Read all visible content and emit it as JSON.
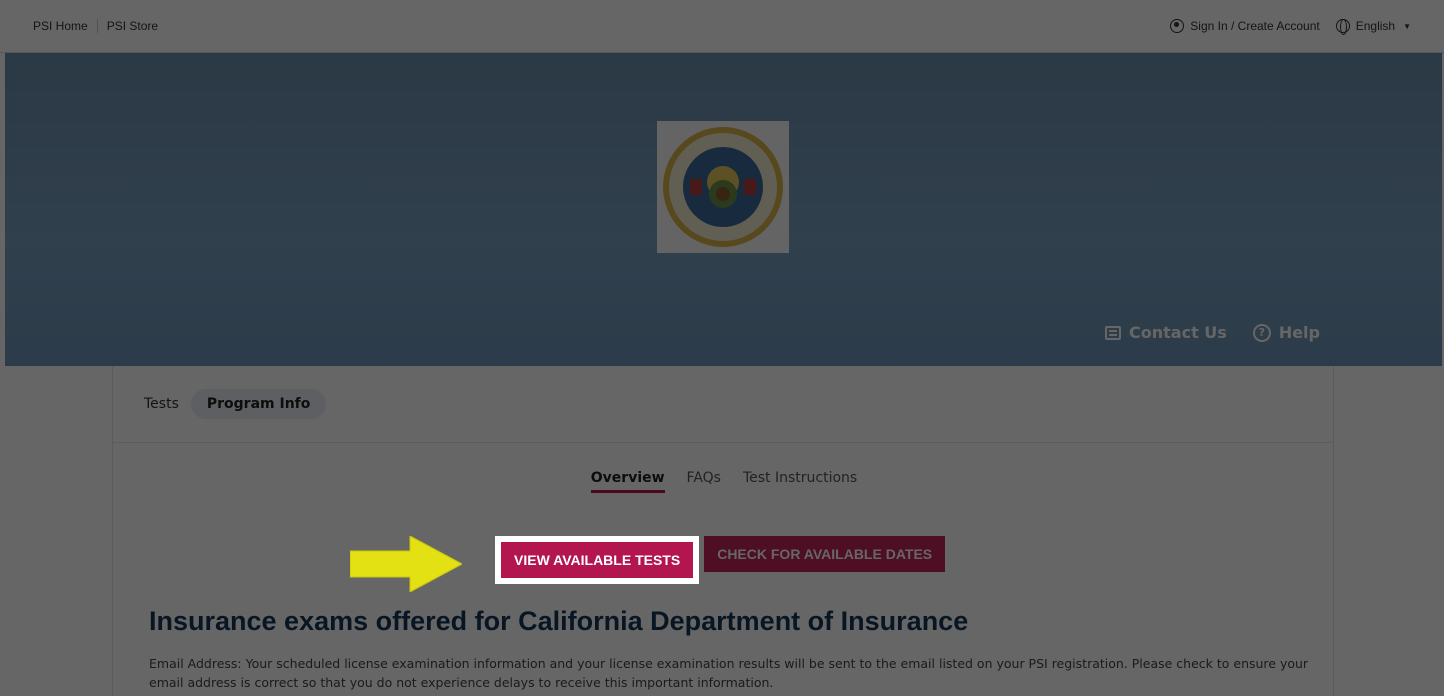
{
  "topbar": {
    "links": [
      "PSI Home",
      "PSI Store"
    ],
    "signin": "Sign In / Create Account",
    "language": "English"
  },
  "hero": {
    "contact": "Contact Us",
    "help": "Help",
    "seal_text_top": "DEPARTMENT OF INSURANCE",
    "seal_text_bottom": "STATE OF CALIFORNIA"
  },
  "tabs": {
    "tests": "Tests",
    "program_info": "Program Info"
  },
  "subtabs": [
    "Overview",
    "FAQs",
    "Test Instructions"
  ],
  "buttons": {
    "view_tests": "VIEW AVAILABLE TESTS",
    "check_dates": "CHECK FOR AVAILABLE DATES"
  },
  "content": {
    "heading": "Insurance exams offered for California Department of Insurance",
    "paragraph": "Email Address: Your scheduled license examination information and your license examination results will be sent to the email listed on your PSI registration. Please check to ensure your email address is correct so that you do not experience delays to receive this important information."
  },
  "colors": {
    "brand": "#b3154e",
    "hero": "#6d8fae",
    "heading": "#14375a",
    "arrow": "#e3e014"
  }
}
